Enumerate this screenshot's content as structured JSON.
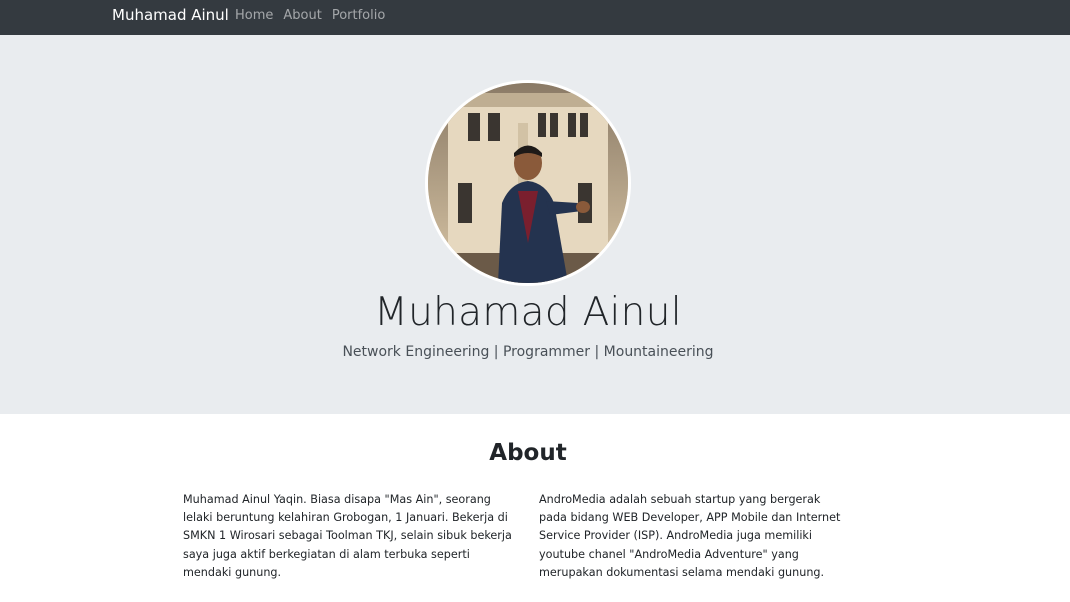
{
  "navbar": {
    "brand": "Muhamad Ainul",
    "links": [
      {
        "label": "Home"
      },
      {
        "label": "About"
      },
      {
        "label": "Portfolio"
      }
    ]
  },
  "hero": {
    "name": "Muhamad Ainul",
    "tagline": "Network Engineering | Programmer | Mountaineering"
  },
  "about": {
    "title": "About",
    "left_text": "Muhamad Ainul Yaqin. Biasa disapa \"Mas Ain\", seorang lelaki beruntung kelahiran Grobogan, 1 Januari. Bekerja di SMKN 1 Wirosari sebagai Toolman TKJ, selain sibuk bekerja saya juga aktif berkegiatan di alam terbuka seperti mendaki gunung.",
    "right_text": "AndroMedia adalah sebuah startup yang bergerak pada bidang WEB Developer, APP Mobile dan Internet Service Provider (ISP). AndroMedia juga memiliki youtube chanel \"AndroMedia Adventure\" yang merupakan dokumentasi selama mendaki gunung."
  }
}
